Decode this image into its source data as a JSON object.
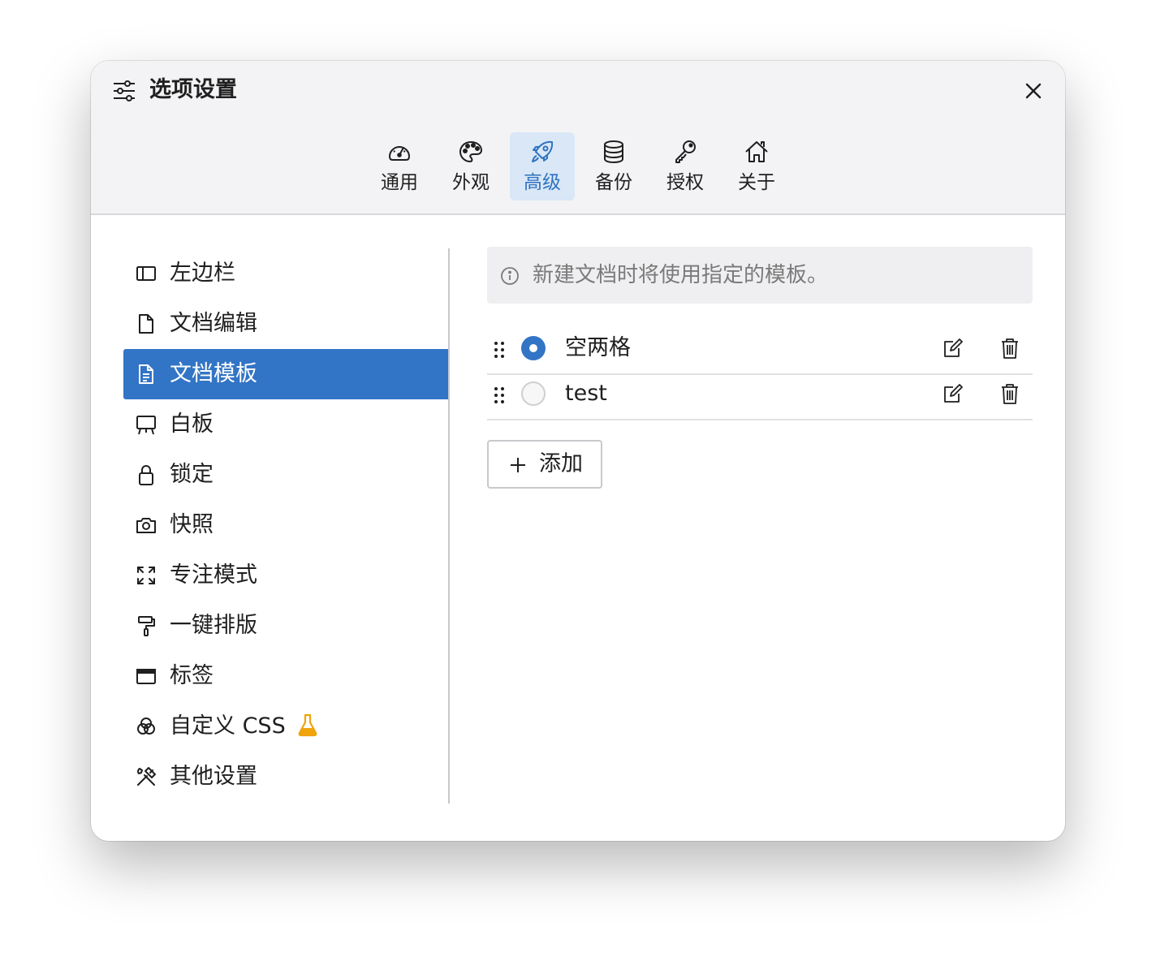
{
  "dialog": {
    "title": "选项设置"
  },
  "tabs": [
    {
      "label": "通用",
      "icon": "speedometer-icon"
    },
    {
      "label": "外观",
      "icon": "palette-icon"
    },
    {
      "label": "高级",
      "icon": "rocket-icon",
      "active": true
    },
    {
      "label": "备份",
      "icon": "database-icon"
    },
    {
      "label": "授权",
      "icon": "key-icon"
    },
    {
      "label": "关于",
      "icon": "house-icon"
    }
  ],
  "sidebar": {
    "items": [
      {
        "label": "左边栏",
        "icon": "layout-sidebar-icon"
      },
      {
        "label": "文档编辑",
        "icon": "file-icon"
      },
      {
        "label": "文档模板",
        "icon": "file-text-icon",
        "active": true
      },
      {
        "label": "白板",
        "icon": "easel-icon"
      },
      {
        "label": "锁定",
        "icon": "lock-icon"
      },
      {
        "label": "快照",
        "icon": "camera-icon"
      },
      {
        "label": "专注模式",
        "icon": "expand-icon"
      },
      {
        "label": "一键排版",
        "icon": "paint-roller-icon"
      },
      {
        "label": "标签",
        "icon": "window-tab-icon"
      },
      {
        "label": "自定义 CSS",
        "icon": "circles-icon",
        "badge": "flask-icon"
      },
      {
        "label": "其他设置",
        "icon": "tools-icon"
      }
    ]
  },
  "content": {
    "info_text": "新建文档时将使用指定的模板。",
    "templates": [
      {
        "name": "空两格",
        "selected": true
      },
      {
        "name": "test",
        "selected": false
      }
    ],
    "add_label": "添加"
  },
  "colors": {
    "accent": "#3274c5",
    "active_tab_bg": "#d9e7f6",
    "header_bg": "#f3f3f5",
    "info_bg": "#efeff1",
    "flask": "#f0a30a"
  }
}
